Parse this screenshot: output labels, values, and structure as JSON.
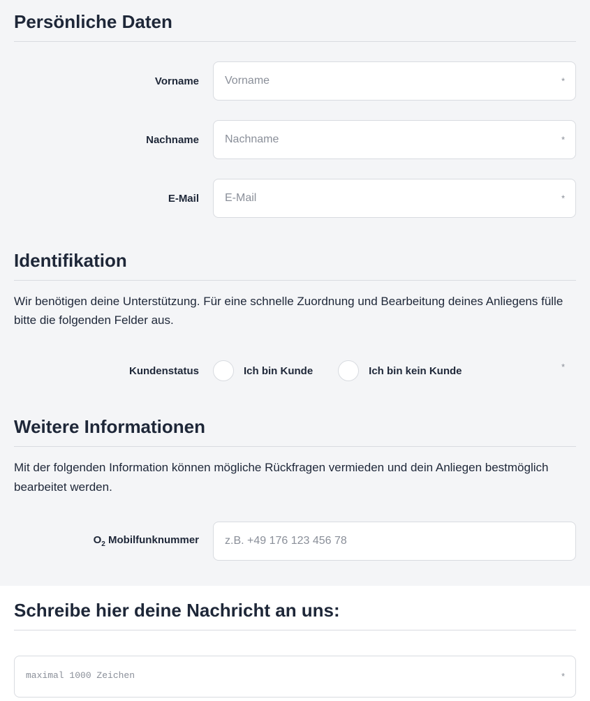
{
  "personal": {
    "title": "Persönliche Daten",
    "firstname_label": "Vorname",
    "firstname_placeholder": "Vorname",
    "lastname_label": "Nachname",
    "lastname_placeholder": "Nachname",
    "email_label": "E-Mail",
    "email_placeholder": "E-Mail"
  },
  "identification": {
    "title": "Identifikation",
    "description": "Wir benötigen deine Unterstützung. Für eine schnelle Zuordnung und Bearbeitung deines Anliegens fülle bitte die folgenden Felder aus.",
    "status_label": "Kundenstatus",
    "option_customer": "Ich bin Kunde",
    "option_not_customer": "Ich bin kein Kunde"
  },
  "further": {
    "title": "Weitere Informationen",
    "description": "Mit der folgenden Information können mögliche Rückfragen vermieden und dein Anliegen bestmöglich bearbeitet werden.",
    "mobile_label_prefix": "O",
    "mobile_label_sub": "2",
    "mobile_label_suffix": " Mobilfunknummer",
    "mobile_placeholder": "z.B. +49 176 123 456 78"
  },
  "message": {
    "title": "Schreibe hier deine Nachricht an uns:",
    "placeholder": "maximal 1000 Zeichen"
  },
  "asterisk": "*"
}
